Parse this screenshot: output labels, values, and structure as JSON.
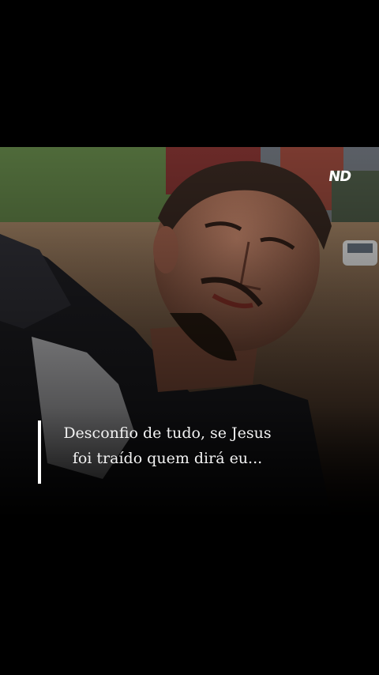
{
  "watermark": {
    "text": "ND"
  },
  "caption": {
    "line1": "Desconfio de tudo, se Jesus",
    "line2": "foi traído quem dirá eu..."
  },
  "colors": {
    "background": "#000000",
    "caption_text": "#f2f2f2",
    "caption_bar": "#ffffff"
  }
}
